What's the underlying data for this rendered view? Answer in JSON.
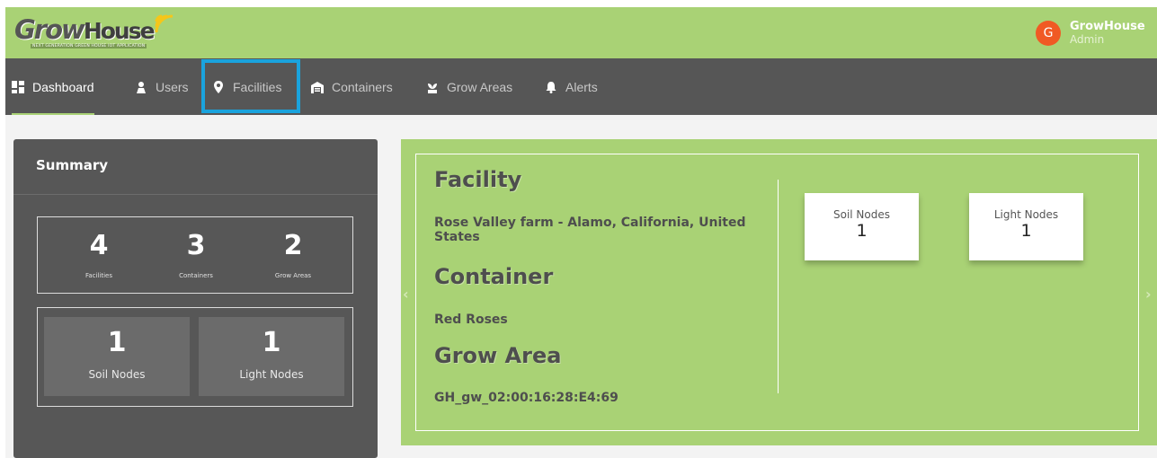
{
  "app": {
    "logo_part1": "Grow",
    "logo_part2": "House",
    "logo_tagline": "NEXT GENERATION GREEN HOUSE IOT APPLICATION"
  },
  "user": {
    "avatar_letter": "G",
    "name": "GrowHouse",
    "role": "Admin"
  },
  "nav": {
    "items": [
      {
        "label": "Dashboard",
        "icon": "dashboard-grid-icon"
      },
      {
        "label": "Users",
        "icon": "user-icon"
      },
      {
        "label": "Facilities",
        "icon": "map-marker-icon"
      },
      {
        "label": "Containers",
        "icon": "warehouse-icon"
      },
      {
        "label": "Grow Areas",
        "icon": "plant-icon"
      },
      {
        "label": "Alerts",
        "icon": "bell-icon"
      }
    ],
    "active": "Dashboard"
  },
  "summary": {
    "title": "Summary",
    "stats": [
      {
        "value": "4",
        "label": "Facilities"
      },
      {
        "value": "3",
        "label": "Containers"
      },
      {
        "value": "2",
        "label": "Grow Areas"
      }
    ],
    "nodes": [
      {
        "value": "1",
        "label": "Soil Nodes"
      },
      {
        "value": "1",
        "label": "Light Nodes"
      }
    ]
  },
  "facility": {
    "facility_heading": "Facility",
    "facility_name": "Rose Valley farm - Alamo, California, United States",
    "container_heading": "Container",
    "container_name": "Red Roses",
    "grow_area_heading": "Grow Area",
    "grow_area_name": "GH_gw_02:00:16:28:E4:69",
    "cards": [
      {
        "label": "Soil Nodes",
        "value": "1"
      },
      {
        "label": "Light Nodes",
        "value": "1"
      }
    ]
  },
  "colors": {
    "brand_green": "#a9d275",
    "nav_dark": "#565656",
    "avatar_orange": "#f05a24",
    "highlight_blue": "#1aa3dd"
  }
}
